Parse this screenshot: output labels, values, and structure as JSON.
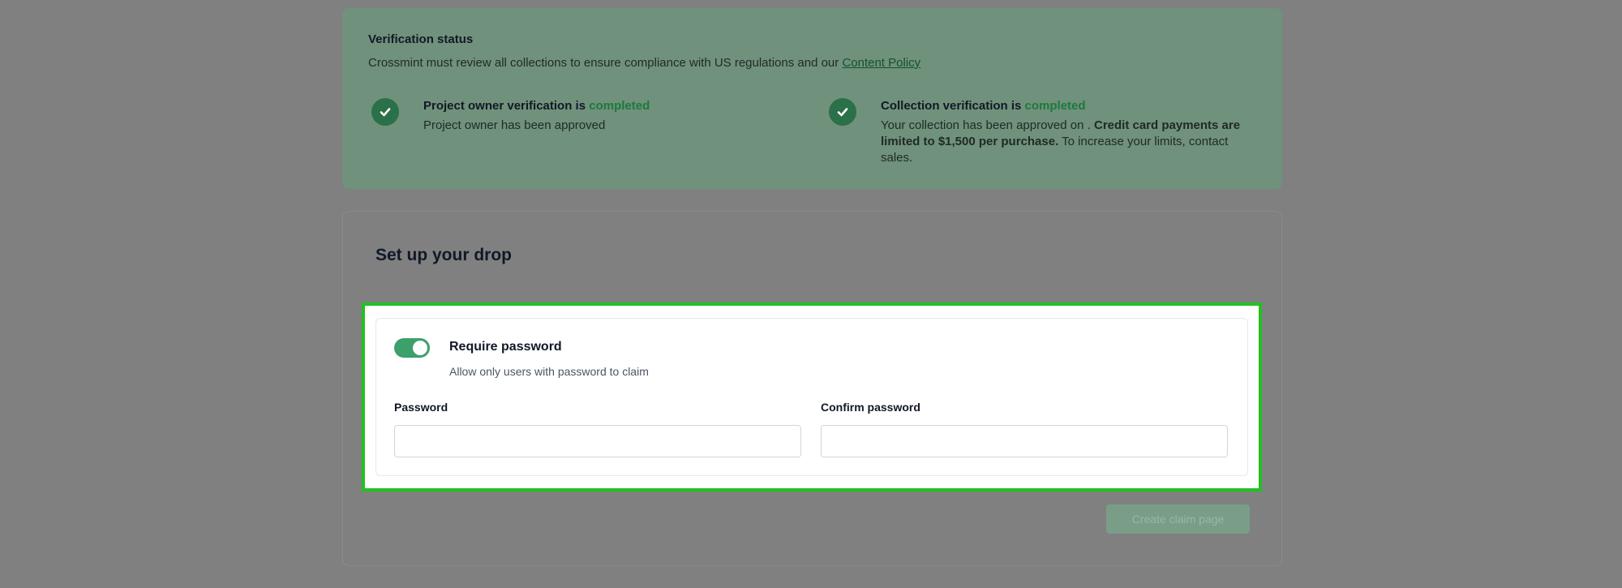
{
  "verification": {
    "title": "Verification status",
    "description": "Crossmint must review all collections to ensure compliance with US regulations and our",
    "policy_link": "Content Policy",
    "project_owner": {
      "label": "Project owner verification is",
      "status": "completed",
      "detail": "Project owner has been approved"
    },
    "collection": {
      "label": "Collection verification is",
      "status": "completed",
      "detail_prefix": "Your collection has been approved on .",
      "detail_bold": "Credit card payments are limited to $1,500 per purchase.",
      "detail_suffix": "To increase your limits, contact sales."
    }
  },
  "setup": {
    "title": "Set up your drop",
    "require_password": {
      "enabled": true,
      "title": "Require password",
      "description": "Allow only users with password to claim"
    },
    "password": {
      "label": "Password",
      "value": ""
    },
    "confirm_password": {
      "label": "Confirm password",
      "value": ""
    },
    "create_button": "Create claim page"
  },
  "colors": {
    "accent_green": "#3d9f6a",
    "highlight_outline": "#22c022",
    "overlay": "#808080"
  }
}
